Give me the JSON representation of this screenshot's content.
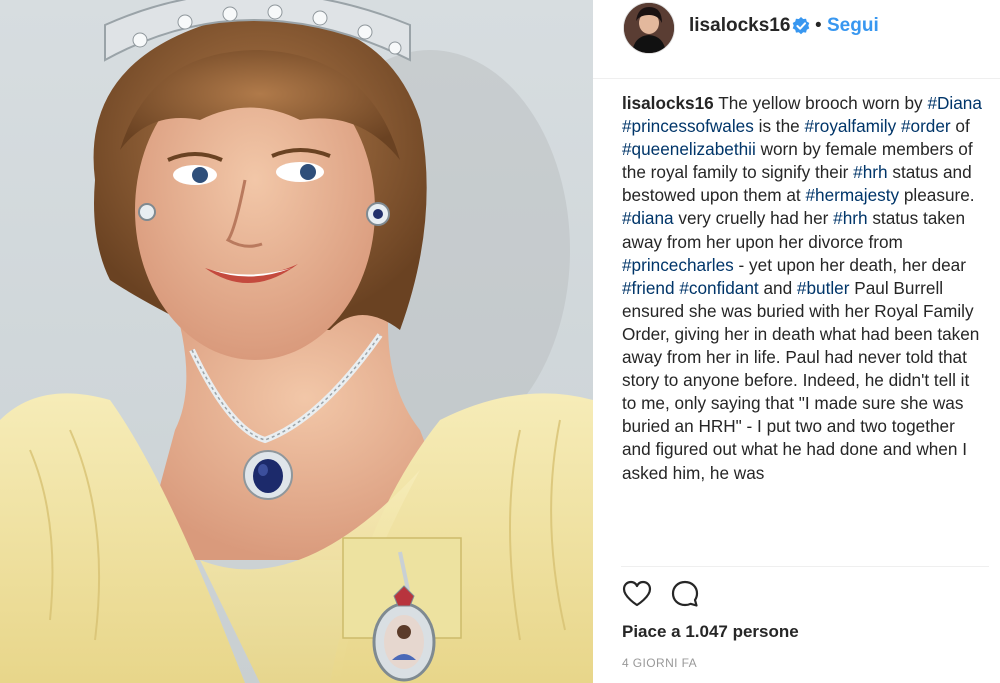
{
  "post": {
    "photo": {
      "description_icon": "portrait-photo",
      "colors": {
        "background": "#d3d9dc",
        "dress": "#f3e7a6",
        "hair": "#8c5a33"
      }
    },
    "header": {
      "username": "lisalocks16",
      "verified_icon": "verified-badge-icon",
      "separator": "•",
      "follow_label": "Segui"
    },
    "caption": {
      "author": "lisalocks16",
      "segments": [
        {
          "t": " The yellow brooch worn by "
        },
        {
          "t": "#Diana",
          "tag": true
        },
        {
          "t": " "
        },
        {
          "t": "#princessofwales",
          "tag": true
        },
        {
          "t": " is the "
        },
        {
          "t": "#royalfamily",
          "tag": true
        },
        {
          "t": " "
        },
        {
          "t": "#order",
          "tag": true
        },
        {
          "t": " of "
        },
        {
          "t": "#queenelizabethii",
          "tag": true
        },
        {
          "t": " worn by female members of the royal family to signify their "
        },
        {
          "t": "#hrh",
          "tag": true
        },
        {
          "t": " status and bestowed upon them at "
        },
        {
          "t": "#hermajesty",
          "tag": true
        },
        {
          "t": " pleasure. "
        },
        {
          "t": "#diana",
          "tag": true
        },
        {
          "t": " very cruelly had her "
        },
        {
          "t": "#hrh",
          "tag": true
        },
        {
          "t": " status taken away from her upon her divorce from "
        },
        {
          "t": "#princecharles",
          "tag": true
        },
        {
          "t": " - yet upon her death, her dear "
        },
        {
          "t": "#friend",
          "tag": true
        },
        {
          "t": " "
        },
        {
          "t": "#confidant",
          "tag": true
        },
        {
          "t": " and "
        },
        {
          "t": "#butler",
          "tag": true
        },
        {
          "t": " Paul Burrell ensured she was buried with her Royal Family Order, giving her in death what had been taken away from her in life. Paul had never told that story to anyone before. Indeed, he didn't tell it to me, only saying that \"I made sure she was buried an HRH\" - I put two and two together and figured out what he had done and when I asked him, he was "
        }
      ],
      "hashtag_color": "#003569"
    },
    "actions": {
      "like_icon": "heart-icon",
      "comment_icon": "comment-icon"
    },
    "likes_text": "Piace a 1.047 persone",
    "timestamp": "4 GIORNI FA",
    "accent_color": "#3897f0"
  }
}
